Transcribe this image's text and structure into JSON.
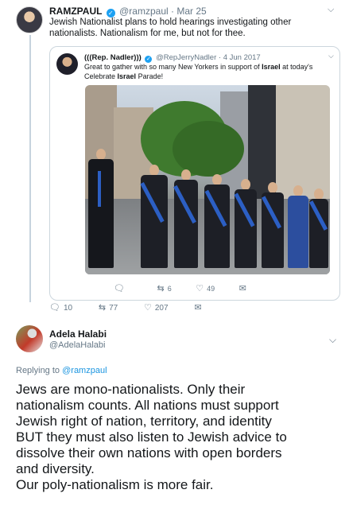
{
  "tweet1": {
    "name": "RAMZPAUL",
    "handle": "@ramzpaul",
    "date": "Mar 25",
    "text": "Jewish Nationalist plans to hold hearings investigating other nationalists. Nationalism for me, but not for thee.",
    "actions": {
      "replies": "10",
      "retweets": "77",
      "likes": "207"
    },
    "quote": {
      "name": "(((Rep. Nadler)))",
      "handle": "@RepJerryNadler",
      "date": "4 Jun 2017",
      "text_part1": "Great to gather with so many New Yorkers in support of ",
      "text_bold1": "Israel",
      "text_part2": " at today's Celebrate ",
      "text_bold2": "Israel",
      "text_part3": " Parade!",
      "actions": {
        "retweets": "6",
        "likes": "49"
      }
    }
  },
  "tweet2": {
    "name": "Adela Halabi",
    "handle": "@AdelaHalabi",
    "replying_prefix": "Replying to",
    "replying_to": "@ramzpaul",
    "lines": [
      "Jews are mono-nationalists. Only their",
      "nationalism counts. All nations must support",
      "Jewish right of nation, territory, and identity",
      "BUT they must also listen to Jewish advice to",
      "dissolve their own nations with open borders",
      "and diversity.",
      "Our poly-nationalism is more fair."
    ]
  },
  "icons": {
    "verified": "verified-badge-icon",
    "chevron": "chevron-down-icon",
    "reply": "reply-icon",
    "retweet": "retweet-icon",
    "like": "heart-icon",
    "dm": "mail-icon"
  },
  "colors": {
    "accent": "#1da1f2",
    "link": "#1b95e0",
    "muted": "#657786"
  }
}
